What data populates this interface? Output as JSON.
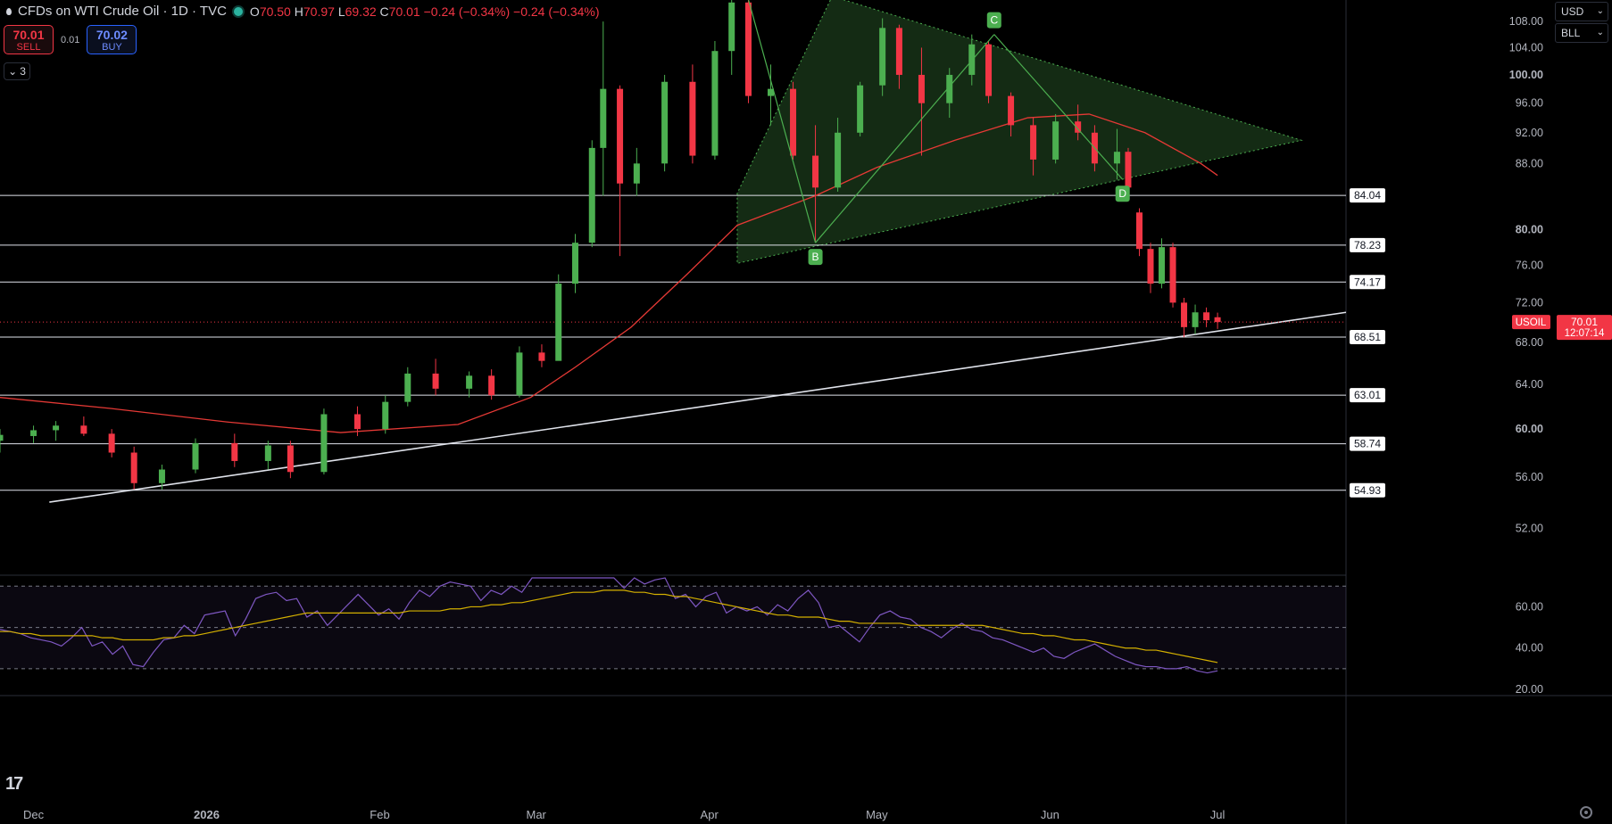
{
  "header": {
    "symbol_title": "CFDs on WTI Crude Oil · 1D · TVC",
    "open_label": "O",
    "open": "70.50",
    "high_label": "H",
    "high": "70.97",
    "low_label": "L",
    "low": "69.32",
    "close_label": "C",
    "close": "70.01",
    "change": "−0.24 (−0.34%)",
    "change2": "−0.24 (−0.34%)",
    "indicator_count": "3"
  },
  "trade": {
    "sell_price": "70.01",
    "sell_label": "SELL",
    "spread": "0.01",
    "buy_price": "70.02",
    "buy_label": "BUY"
  },
  "toolbar": {
    "currency": "USD",
    "unit": "BLL"
  },
  "colors": {
    "up": "#4caf50",
    "down": "#f23645",
    "ma": "#e53935",
    "rsi": "#7e57c2",
    "rsi_ma": "#d4b000",
    "triangle_fill": "#1b3a1b",
    "pattern_line": "#4caf50"
  },
  "chart_data": [
    {
      "type": "candlestick",
      "title": "CFDs on WTI Crude Oil · 1D · TVC",
      "x_tick_labels": [
        "Dec",
        "2026",
        "Feb",
        "Mar",
        "Apr",
        "May",
        "Jun",
        "Jul"
      ],
      "x_tick_dates": [
        "2025-12-01",
        "2026-01-01",
        "2026-02-01",
        "2026-03-01",
        "2026-04-01",
        "2026-05-01",
        "2026-06-01",
        "2026-07-01"
      ],
      "y_tick_labels": [
        "52.00",
        "56.00",
        "60.00",
        "64.00",
        "68.00",
        "72.00",
        "76.00",
        "80.00",
        "88.00",
        "92.00",
        "96.00",
        "100.00",
        "104.00",
        "108.00"
      ],
      "ylim": [
        48.6,
        111.4
      ],
      "xlim": [
        "2025-11-25",
        "2026-07-24"
      ],
      "scale": "log",
      "grid": false,
      "ohlc_points": [
        {
          "date": "2025-11-25",
          "o": 59.0,
          "h": 60.0,
          "l": 58.0,
          "c": 59.5
        },
        {
          "date": "2025-12-01",
          "o": 59.4,
          "h": 60.3,
          "l": 58.8,
          "c": 59.9
        },
        {
          "date": "2025-12-05",
          "o": 59.9,
          "h": 60.7,
          "l": 59.0,
          "c": 60.3
        },
        {
          "date": "2025-12-10",
          "o": 60.3,
          "h": 61.1,
          "l": 59.4,
          "c": 59.6
        },
        {
          "date": "2025-12-15",
          "o": 59.6,
          "h": 60.0,
          "l": 57.6,
          "c": 58.0
        },
        {
          "date": "2025-12-19",
          "o": 58.0,
          "h": 58.5,
          "l": 55.0,
          "c": 55.5
        },
        {
          "date": "2025-12-24",
          "o": 55.5,
          "h": 57.0,
          "l": 55.0,
          "c": 56.6
        },
        {
          "date": "2025-12-30",
          "o": 56.6,
          "h": 59.2,
          "l": 56.3,
          "c": 58.8
        },
        {
          "date": "2026-01-06",
          "o": 58.8,
          "h": 59.6,
          "l": 56.8,
          "c": 57.3
        },
        {
          "date": "2026-01-12",
          "o": 57.3,
          "h": 59.0,
          "l": 56.6,
          "c": 58.6
        },
        {
          "date": "2026-01-16",
          "o": 58.6,
          "h": 59.0,
          "l": 55.9,
          "c": 56.4
        },
        {
          "date": "2026-01-22",
          "o": 56.4,
          "h": 61.8,
          "l": 56.2,
          "c": 61.3
        },
        {
          "date": "2026-01-28",
          "o": 61.3,
          "h": 62.0,
          "l": 59.4,
          "c": 60.0
        },
        {
          "date": "2026-02-02",
          "o": 60.0,
          "h": 63.0,
          "l": 59.6,
          "c": 62.4
        },
        {
          "date": "2026-02-06",
          "o": 62.4,
          "h": 65.6,
          "l": 62.0,
          "c": 65.0
        },
        {
          "date": "2026-02-11",
          "o": 65.0,
          "h": 66.4,
          "l": 63.0,
          "c": 63.6
        },
        {
          "date": "2026-02-17",
          "o": 63.6,
          "h": 65.2,
          "l": 62.8,
          "c": 64.8
        },
        {
          "date": "2026-02-21",
          "o": 64.8,
          "h": 65.4,
          "l": 62.6,
          "c": 63.0
        },
        {
          "date": "2026-02-26",
          "o": 63.0,
          "h": 67.6,
          "l": 62.8,
          "c": 67.0
        },
        {
          "date": "2026-03-02",
          "o": 67.0,
          "h": 67.8,
          "l": 65.6,
          "c": 66.2
        },
        {
          "date": "2026-03-05",
          "o": 66.2,
          "h": 75.0,
          "l": 68.0,
          "c": 74.0
        },
        {
          "date": "2026-03-08",
          "o": 74.0,
          "h": 79.5,
          "l": 73.0,
          "c": 78.5
        },
        {
          "date": "2026-03-11",
          "o": 78.5,
          "h": 91.0,
          "l": 78.0,
          "c": 90.0
        },
        {
          "date": "2026-03-13",
          "o": 90.0,
          "h": 108.0,
          "l": 84.0,
          "c": 98.0
        },
        {
          "date": "2026-03-16",
          "o": 98.0,
          "h": 98.5,
          "l": 77.0,
          "c": 85.5
        },
        {
          "date": "2026-03-19",
          "o": 85.5,
          "h": 90.0,
          "l": 84.0,
          "c": 88.0
        },
        {
          "date": "2026-03-24",
          "o": 88.0,
          "h": 100.0,
          "l": 87.0,
          "c": 99.0
        },
        {
          "date": "2026-03-29",
          "o": 99.0,
          "h": 101.5,
          "l": 88.0,
          "c": 89.0
        },
        {
          "date": "2026-04-02",
          "o": 89.0,
          "h": 105.0,
          "l": 88.5,
          "c": 103.5
        },
        {
          "date": "2026-04-05",
          "o": 103.5,
          "h": 112.0,
          "l": 100.0,
          "c": 111.0
        },
        {
          "date": "2026-04-08",
          "o": 111.0,
          "h": 112.0,
          "l": 96.0,
          "c": 97.0
        },
        {
          "date": "2026-04-12",
          "o": 97.0,
          "h": 101.5,
          "l": 93.0,
          "c": 98.0
        },
        {
          "date": "2026-04-16",
          "o": 98.0,
          "h": 99.0,
          "l": 88.5,
          "c": 89.0
        },
        {
          "date": "2026-04-20",
          "o": 89.0,
          "h": 93.0,
          "l": 78.5,
          "c": 85.0
        },
        {
          "date": "2026-04-24",
          "o": 85.0,
          "h": 94.0,
          "l": 84.5,
          "c": 92.0
        },
        {
          "date": "2026-04-28",
          "o": 92.0,
          "h": 99.0,
          "l": 91.5,
          "c": 98.5
        },
        {
          "date": "2026-05-02",
          "o": 98.5,
          "h": 108.5,
          "l": 97.0,
          "c": 107.0
        },
        {
          "date": "2026-05-05",
          "o": 107.0,
          "h": 107.5,
          "l": 98.0,
          "c": 100.0
        },
        {
          "date": "2026-05-09",
          "o": 100.0,
          "h": 104.0,
          "l": 89.0,
          "c": 96.0
        },
        {
          "date": "2026-05-14",
          "o": 96.0,
          "h": 101.0,
          "l": 94.0,
          "c": 100.0
        },
        {
          "date": "2026-05-18",
          "o": 100.0,
          "h": 106.0,
          "l": 98.5,
          "c": 104.5
        },
        {
          "date": "2026-05-21",
          "o": 104.5,
          "h": 105.0,
          "l": 96.0,
          "c": 97.0
        },
        {
          "date": "2026-05-25",
          "o": 97.0,
          "h": 97.5,
          "l": 91.5,
          "c": 93.0
        },
        {
          "date": "2026-05-29",
          "o": 93.0,
          "h": 94.0,
          "l": 86.5,
          "c": 88.5
        },
        {
          "date": "2026-06-02",
          "o": 88.5,
          "h": 94.5,
          "l": 88.0,
          "c": 93.5
        },
        {
          "date": "2026-06-06",
          "o": 93.5,
          "h": 95.8,
          "l": 91.0,
          "c": 92.0
        },
        {
          "date": "2026-06-09",
          "o": 92.0,
          "h": 93.0,
          "l": 87.0,
          "c": 88.0
        },
        {
          "date": "2026-06-13",
          "o": 88.0,
          "h": 92.5,
          "l": 86.0,
          "c": 89.5
        },
        {
          "date": "2026-06-15",
          "o": 89.5,
          "h": 90.0,
          "l": 83.5,
          "c": 85.0
        },
        {
          "date": "2026-06-17",
          "o": 82.0,
          "h": 82.5,
          "l": 77.0,
          "c": 77.8
        },
        {
          "date": "2026-06-19",
          "o": 77.8,
          "h": 78.5,
          "l": 73.0,
          "c": 74.0
        },
        {
          "date": "2026-06-21",
          "o": 74.0,
          "h": 79.0,
          "l": 73.5,
          "c": 78.0
        },
        {
          "date": "2026-06-23",
          "o": 78.0,
          "h": 78.5,
          "l": 71.5,
          "c": 72.0
        },
        {
          "date": "2026-06-25",
          "o": 72.0,
          "h": 72.5,
          "l": 68.5,
          "c": 69.5
        },
        {
          "date": "2026-06-27",
          "o": 69.5,
          "h": 71.8,
          "l": 68.8,
          "c": 71.0
        },
        {
          "date": "2026-06-29",
          "o": 71.0,
          "h": 71.5,
          "l": 69.5,
          "c": 70.2
        },
        {
          "date": "2026-07-01",
          "o": 70.5,
          "h": 70.97,
          "l": 69.32,
          "c": 70.01
        }
      ],
      "moving_average": [
        {
          "date": "2025-11-25",
          "v": 62.8
        },
        {
          "date": "2025-12-15",
          "v": 61.8
        },
        {
          "date": "2026-01-05",
          "v": 60.6
        },
        {
          "date": "2026-01-25",
          "v": 59.7
        },
        {
          "date": "2026-02-15",
          "v": 60.4
        },
        {
          "date": "2026-02-28",
          "v": 62.8
        },
        {
          "date": "2026-03-08",
          "v": 65.6
        },
        {
          "date": "2026-03-18",
          "v": 69.5
        },
        {
          "date": "2026-03-28",
          "v": 75.0
        },
        {
          "date": "2026-04-06",
          "v": 80.5
        },
        {
          "date": "2026-04-20",
          "v": 84.0
        },
        {
          "date": "2026-05-01",
          "v": 87.5
        },
        {
          "date": "2026-05-15",
          "v": 91.0
        },
        {
          "date": "2026-05-28",
          "v": 94.0
        },
        {
          "date": "2026-06-08",
          "v": 94.5
        },
        {
          "date": "2026-06-18",
          "v": 92.0
        },
        {
          "date": "2026-06-28",
          "v": 88.0
        },
        {
          "date": "2026-07-01",
          "v": 86.5
        }
      ],
      "horizontal_levels": [
        "84.04",
        "78.23",
        "74.17",
        "68.51",
        "63.01",
        "58.74",
        "54.93"
      ],
      "trendline": [
        {
          "date": "2025-11-30",
          "v": 54.0
        },
        {
          "date": "2026-07-24",
          "v": 71.0
        }
      ],
      "triangle": [
        {
          "date": "2026-04-06",
          "v": 84.3
        },
        {
          "date": "2026-04-06",
          "v": 76.2
        },
        {
          "date": "2026-07-16",
          "v": 91.0
        },
        {
          "date": "2026-04-23",
          "v": 112.0
        }
      ],
      "pattern": [
        {
          "label": "",
          "date": "2026-04-08",
          "v": 111.5
        },
        {
          "label": "B",
          "date": "2026-04-20",
          "v": 78.5
        },
        {
          "label": "C",
          "date": "2026-05-22",
          "v": 106.0
        },
        {
          "label": "D",
          "date": "2026-06-14",
          "v": 86.0
        }
      ],
      "current_price": {
        "symbol": "USOIL",
        "price": "70.01",
        "countdown": "12:07:14",
        "v": 70.01
      }
    },
    {
      "type": "line",
      "y_tick_labels": [
        "20.00",
        "40.00",
        "60.00"
      ],
      "ylim": [
        17,
        74
      ],
      "levels": [
        70,
        50,
        30
      ],
      "series": [
        {
          "values": [
            49,
            48,
            47,
            45,
            44,
            43,
            41,
            45,
            50,
            41,
            43,
            37,
            41,
            32,
            31,
            38,
            44,
            45,
            51,
            47,
            56,
            57,
            58,
            46,
            54,
            64,
            66,
            67,
            63,
            64,
            55,
            58,
            51,
            56,
            61,
            66,
            61,
            56,
            59,
            54,
            62,
            68,
            65,
            70,
            72,
            71,
            70,
            63,
            68,
            66,
            70,
            67,
            75,
            77,
            80,
            83,
            84,
            80,
            77,
            79,
            74,
            69,
            74,
            71,
            73,
            75,
            64,
            66,
            60,
            65,
            67,
            57,
            60,
            58,
            60,
            56,
            61,
            58,
            64,
            68,
            62,
            50,
            51,
            47,
            43,
            50,
            56,
            58,
            55,
            54,
            50,
            48,
            45,
            49,
            52,
            49,
            48,
            45,
            44,
            42,
            40,
            38,
            40,
            36,
            35,
            38,
            40,
            42,
            39,
            36,
            34,
            32,
            31,
            31,
            30,
            30,
            31,
            29,
            28,
            29
          ]
        },
        {
          "values": [
            48,
            48,
            47,
            47,
            46,
            46,
            46,
            46,
            46,
            46,
            45,
            45,
            44,
            44,
            44,
            44,
            45,
            45,
            46,
            46,
            47,
            48,
            49,
            50,
            51,
            52,
            53,
            54,
            55,
            56,
            57,
            57,
            57,
            57,
            57,
            57,
            57,
            57,
            57,
            57,
            58,
            58,
            58,
            58,
            59,
            59,
            60,
            60,
            61,
            61,
            62,
            62,
            63,
            64,
            65,
            66,
            67,
            67,
            67,
            68,
            68,
            68,
            67,
            67,
            66,
            66,
            65,
            65,
            64,
            63,
            62,
            61,
            60,
            59,
            58,
            57,
            56,
            56,
            55,
            55,
            55,
            54,
            53,
            53,
            52,
            52,
            52,
            52,
            52,
            51,
            51,
            51,
            51,
            51,
            51,
            51,
            51,
            50,
            49,
            48,
            47,
            47,
            46,
            46,
            45,
            44,
            44,
            43,
            42,
            41,
            40,
            40,
            39,
            39,
            38,
            37,
            36,
            35,
            34,
            33
          ]
        }
      ]
    }
  ]
}
